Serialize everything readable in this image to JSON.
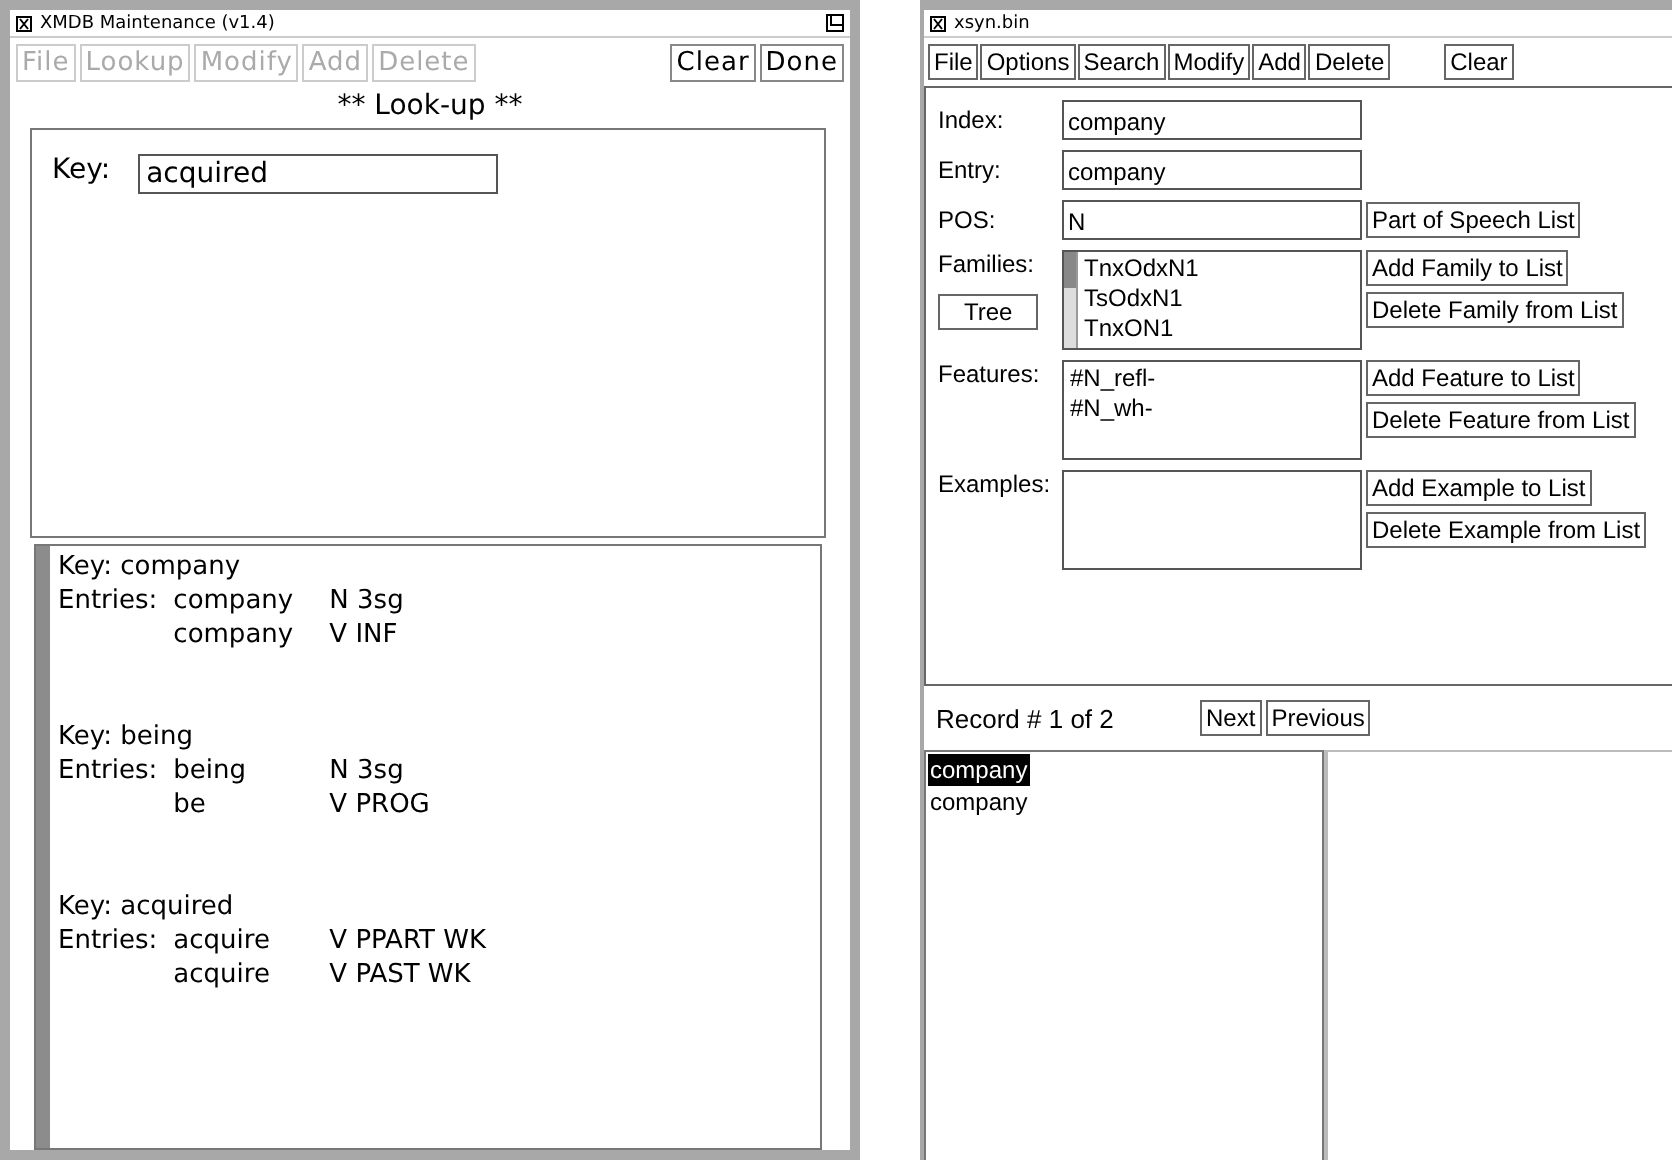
{
  "left_window": {
    "title": "XMDB Maintenance (v1.4)",
    "menu": [
      {
        "label": "File",
        "disabled": true
      },
      {
        "label": "Lookup",
        "disabled": true
      },
      {
        "label": "Modify",
        "disabled": true
      },
      {
        "label": "Add",
        "disabled": true
      },
      {
        "label": "Delete",
        "disabled": true
      }
    ],
    "buttons": [
      "Clear",
      "Done"
    ],
    "heading": "** Look-up **",
    "key_field": {
      "label": "Key:",
      "value": "acquired"
    },
    "results": [
      {
        "key": "Key: company",
        "entries_label": "Entries:",
        "entries": [
          {
            "word": "company",
            "tags": "N 3sg"
          },
          {
            "word": "company",
            "tags": "V INF"
          }
        ]
      },
      {
        "key": "Key: being",
        "entries_label": "Entries:",
        "entries": [
          {
            "word": "being",
            "tags": "N 3sg"
          },
          {
            "word": "be",
            "tags": "V PROG"
          }
        ]
      },
      {
        "key": "Key: acquired",
        "entries_label": "Entries:",
        "entries": [
          {
            "word": "acquire",
            "tags": "V PPART WK"
          },
          {
            "word": "acquire",
            "tags": "V PAST WK"
          }
        ]
      }
    ]
  },
  "right_window": {
    "title": "xsyn.bin",
    "menu": [
      {
        "label": "File",
        "disabled": false
      },
      {
        "label": "Options",
        "disabled": false
      },
      {
        "label": "Search",
        "disabled": false
      },
      {
        "label": "Modify",
        "disabled": false
      },
      {
        "label": "Add",
        "disabled": false
      },
      {
        "label": "Delete",
        "disabled": false
      }
    ],
    "clear_button": "Clear",
    "fields": [
      {
        "label": "Index:",
        "value": "company"
      },
      {
        "label": "Entry:",
        "value": "company"
      },
      {
        "label": "POS:",
        "value": "N",
        "button": "Part of Speech List"
      }
    ],
    "lists": [
      {
        "label": "Families:",
        "extra_button": "Tree",
        "items": [
          "TnxOdxN1",
          "TsOdxN1",
          "TnxON1"
        ],
        "buttons": [
          "Add Family to List",
          "Delete Family from List"
        ]
      },
      {
        "label": "Features:",
        "items": [
          "#N_refl-",
          "#N_wh-"
        ],
        "buttons": [
          "Add Feature to List",
          "Delete Feature from List"
        ]
      },
      {
        "label": "Examples:",
        "buttons": [
          "Add Example to List",
          "Delete Example from List"
        ]
      }
    ],
    "record": "Record # 1 of 2",
    "nav_buttons": [
      "Next",
      "Previous"
    ],
    "records": [
      {
        "label": "company",
        "selected": true
      },
      {
        "label": "company",
        "selected": false
      }
    ]
  }
}
